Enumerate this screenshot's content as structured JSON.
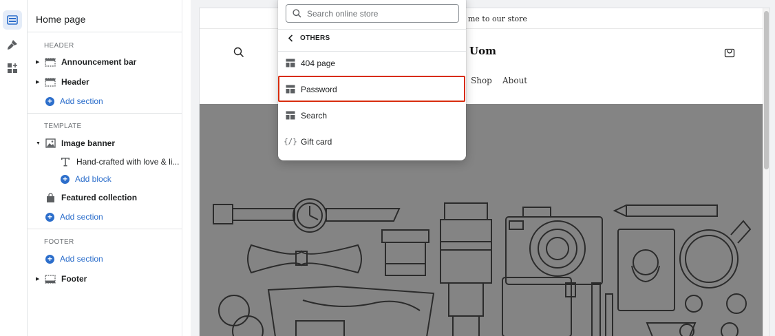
{
  "sidebar": {
    "title": "Home page",
    "header_label": "HEADER",
    "template_label": "TEMPLATE",
    "footer_label": "FOOTER",
    "announcement_bar": "Announcement bar",
    "header": "Header",
    "add_section": "Add section",
    "image_banner": "Image banner",
    "banner_text_block": "Hand-crafted with love & li...",
    "add_block": "Add block",
    "featured_collection": "Featured collection",
    "footer": "Footer"
  },
  "preview": {
    "announcement": "me to our store",
    "store_name": "Uom",
    "nav": [
      "Shop",
      "About"
    ]
  },
  "dropdown": {
    "search_placeholder": "Search online store",
    "group_label": "OTHERS",
    "items": [
      "404 page",
      "Password",
      "Search",
      "Gift card"
    ],
    "highlighted_item": "Password"
  },
  "colors": {
    "accent_blue": "#2c6ecb",
    "highlight_red": "#d82c0d",
    "banner_gray": "#848484"
  }
}
